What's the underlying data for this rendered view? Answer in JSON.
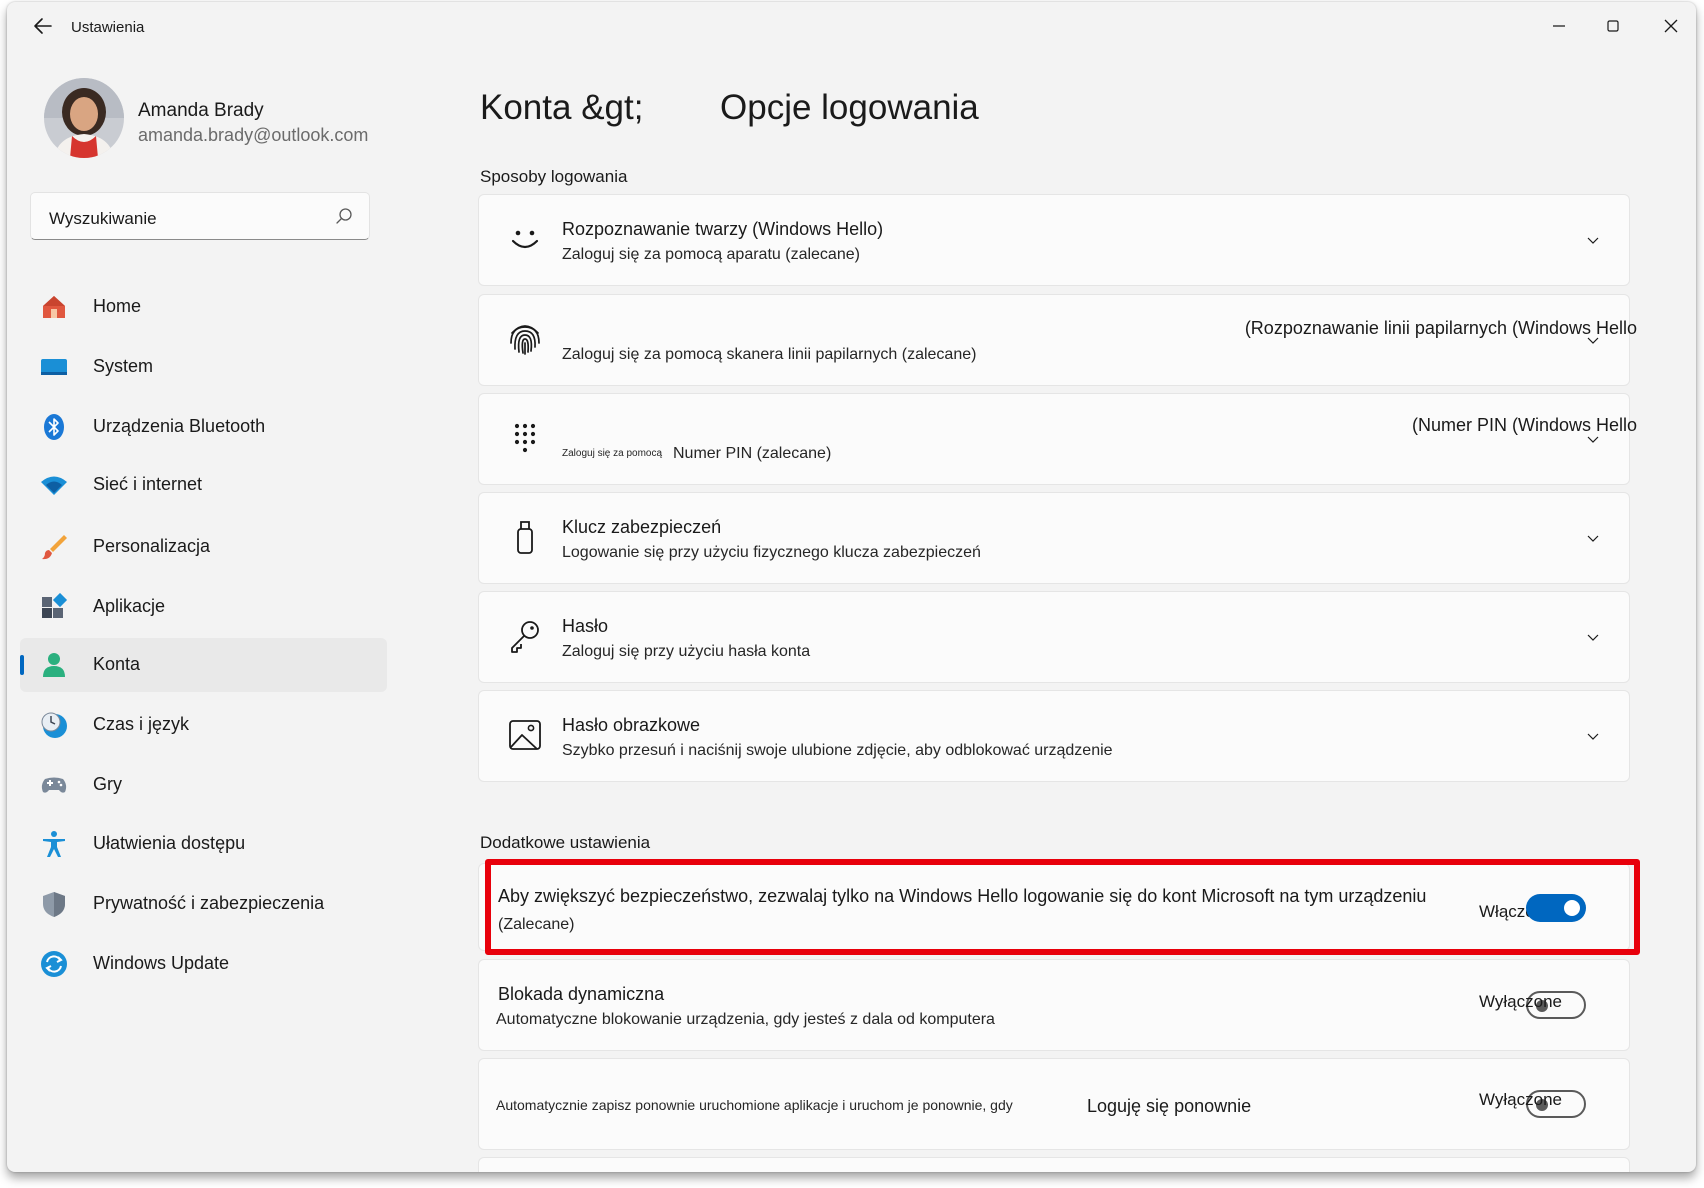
{
  "window": {
    "title": "Ustawienia"
  },
  "profile": {
    "name": "Amanda Brady",
    "email": "amanda.brady@outlook.com"
  },
  "search": {
    "placeholder": "Wyszukiwanie"
  },
  "sidebar": {
    "items": [
      {
        "label": "Home",
        "icon": "home-icon"
      },
      {
        "label": "System",
        "icon": "system-icon"
      },
      {
        "label": "Urządzenia Bluetooth",
        "icon": "bluetooth-icon"
      },
      {
        "label": "Sieć i internet",
        "icon": "wifi-icon"
      },
      {
        "label": "Personalizacja",
        "icon": "brush-icon"
      },
      {
        "label": "Aplikacje",
        "icon": "apps-icon"
      },
      {
        "label": "Konta",
        "icon": "accounts-icon",
        "active": true
      },
      {
        "label": "Czas i język",
        "icon": "time-language-icon"
      },
      {
        "label": "Gry",
        "icon": "gamepad-icon"
      },
      {
        "label": "Ułatwienia dostępu",
        "icon": "accessibility-icon"
      },
      {
        "label": "Prywatność i zabezpieczenia",
        "icon": "shield-icon"
      },
      {
        "label": "Windows Update",
        "icon": "update-icon"
      }
    ]
  },
  "header": {
    "breadcrumb": "Konta &gt;",
    "title": "Opcje logowania"
  },
  "signin": {
    "section_title": "Sposoby logowania",
    "options": [
      {
        "title": "Rozpoznawanie twarzy (Windows Hello)",
        "subtitle": "Zaloguj się za pomocą aparatu (zalecane)",
        "icon": "face-icon"
      },
      {
        "title": "(Rozpoznawanie linii papilarnych (Windows Hello",
        "subtitle": "Zaloguj się za pomocą skanera linii papilarnych (zalecane)",
        "icon": "fingerprint-icon"
      },
      {
        "title": "(Numer PIN (Windows Hello",
        "subtitle_small": "Zaloguj się za pomocą",
        "subtitle": "Numer PIN (zalecane)",
        "icon": "pin-keypad-icon"
      },
      {
        "title": "Klucz zabezpieczeń",
        "subtitle": "Logowanie się przy użyciu fizycznego klucza zabezpieczeń",
        "icon": "usb-key-icon"
      },
      {
        "title": "Hasło",
        "subtitle": "Zaloguj się przy użyciu hasła konta",
        "icon": "key-icon"
      },
      {
        "title": "Hasło obrazkowe",
        "subtitle": "Szybko przesuń i naciśnij swoje ulubione zdjęcie, aby odblokować urządzenie",
        "icon": "picture-icon"
      }
    ]
  },
  "additional": {
    "section_title": "Dodatkowe ustawienia",
    "settings": [
      {
        "title": "Aby zwiększyć bezpieczeństwo, zezwalaj tylko na Windows Hello logowanie się do kont Microsoft na tym urządzeniu",
        "subtitle": "(Zalecane)",
        "state_label": "Włączone",
        "state": true
      },
      {
        "title": "Blokada dynamiczna",
        "subtitle": "Automatyczne blokowanie urządzenia, gdy jesteś z dala od komputera",
        "state_label": "Wyłączone",
        "state": false
      },
      {
        "text_small": "Automatycznie zapisz ponownie uruchomione aplikacje i uruchom je ponownie, gdy",
        "text_bold": "Loguję się ponownie",
        "state_label": "Wyłączone",
        "state": false
      }
    ]
  },
  "colors": {
    "accent": "#0067c0",
    "highlight": "#e8000b",
    "background": "#f3f3f3",
    "card": "#fbfbfb"
  }
}
